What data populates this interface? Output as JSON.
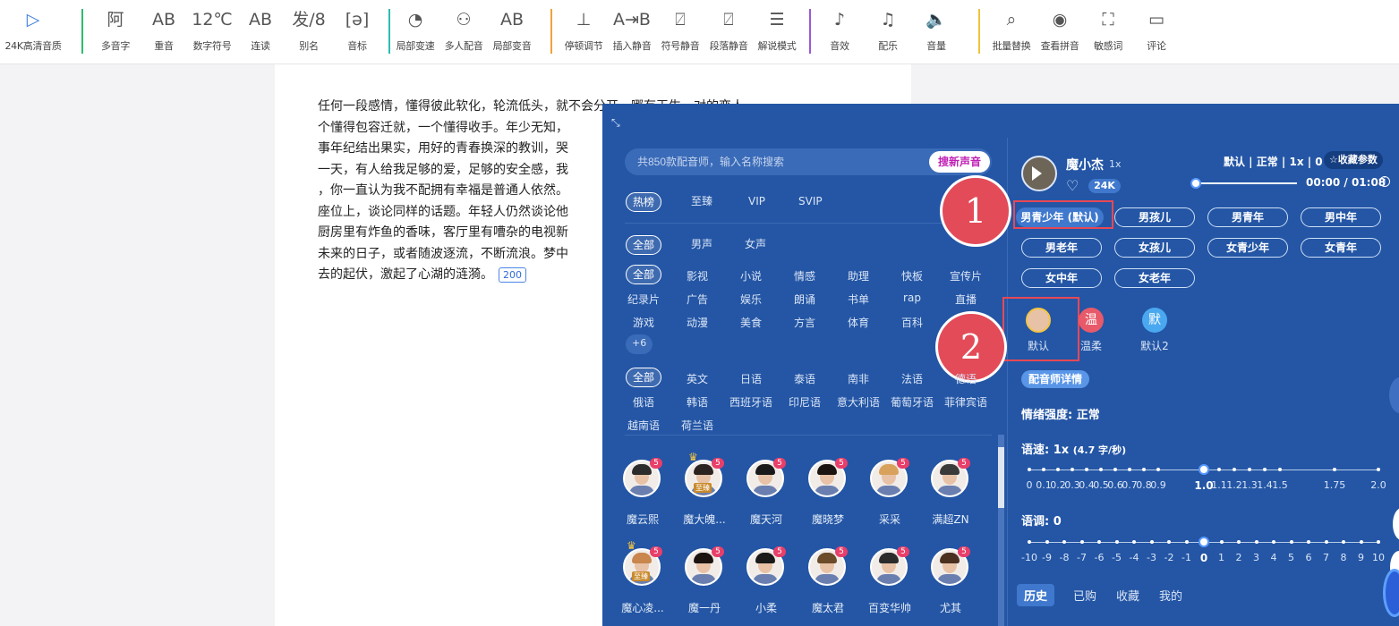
{
  "toolbar": {
    "items": [
      {
        "label": "24K高清音质",
        "icon": "play-circle-icon",
        "glyph": "▷"
      },
      {
        "label": "多音字",
        "icon": "polyphone-icon",
        "glyph": "阿"
      },
      {
        "label": "重音",
        "icon": "stress-icon",
        "glyph": "AB"
      },
      {
        "label": "数字符号",
        "icon": "number-symbol-icon",
        "glyph": "12℃"
      },
      {
        "label": "连读",
        "icon": "liaison-icon",
        "glyph": "AB"
      },
      {
        "label": "别名",
        "icon": "alias-icon",
        "glyph": "发/8"
      },
      {
        "label": "音标",
        "icon": "phonetic-icon",
        "glyph": "[ə]"
      },
      {
        "label": "局部变速",
        "icon": "speed-gauge-icon",
        "glyph": "◔"
      },
      {
        "label": "多人配音",
        "icon": "multi-person-icon",
        "glyph": "⚇"
      },
      {
        "label": "局部变音",
        "icon": "voice-change-icon",
        "glyph": "AB"
      },
      {
        "label": "停顿调节",
        "icon": "pause-adjust-icon",
        "glyph": "⊥"
      },
      {
        "label": "插入静音",
        "icon": "insert-silence-icon",
        "glyph": "A⇥B"
      },
      {
        "label": "符号静音",
        "icon": "symbol-silence-icon",
        "glyph": "⍁"
      },
      {
        "label": "段落静音",
        "icon": "paragraph-silence-icon",
        "glyph": "⍁"
      },
      {
        "label": "解说模式",
        "icon": "narration-mode-icon",
        "glyph": "☰"
      },
      {
        "label": "音效",
        "icon": "sound-effect-icon",
        "glyph": "♪"
      },
      {
        "label": "配乐",
        "icon": "music-icon",
        "glyph": "♫"
      },
      {
        "label": "音量",
        "icon": "volume-icon",
        "glyph": "🔈"
      },
      {
        "label": "批量替换",
        "icon": "search-icon",
        "glyph": "⌕"
      },
      {
        "label": "查看拼音",
        "icon": "eye-icon",
        "glyph": "◉"
      },
      {
        "label": "敏感词",
        "icon": "sensitive-word-icon",
        "glyph": "⛶"
      },
      {
        "label": "评论",
        "icon": "comment-icon",
        "glyph": "▭"
      }
    ]
  },
  "doc": {
    "lines": [
      "任何一段感情，懂得彼此软化，轮流低头，就不会分开，哪有天生一对的恋人",
      "个懂得包容迁就，一个懂得收手。年少无知，",
      "事年纪结出果实，用好的青春换深的教训，哭",
      "一天，有人给我足够的爱，足够的安全感，我",
      "，你一直认为我不配拥有幸福是普通人依然。",
      "座位上，谈论同样的话题。年轻人仍然谈论他",
      "厨房里有炸鱼的香味，客厅里有嘈杂的电视新",
      "未来的日子，或者随波逐流，不断流浪。梦中",
      "去的起伏，激起了心湖的涟漪。"
    ],
    "char_count": "200"
  },
  "panel": {
    "search_placeholder": "共850款配音师，输入名称搜索",
    "find_new": "搜新声音",
    "rank_tabs": [
      "热榜",
      "至臻",
      "VIP",
      "SVIP"
    ],
    "gender_tabs": [
      "全部",
      "男声",
      "女声"
    ],
    "categories": [
      "全部",
      "影视",
      "小说",
      "情感",
      "助理",
      "快板",
      "宣传片",
      "纪录片",
      "广告",
      "娱乐",
      "朗诵",
      "书单",
      "rap",
      "直播",
      "游戏",
      "动漫",
      "美食",
      "方言",
      "体育",
      "百科"
    ],
    "more": "+6",
    "languages": [
      "全部",
      "英文",
      "日语",
      "泰语",
      "南非",
      "法语",
      "德语",
      "俄语",
      "韩语",
      "西班牙语",
      "印尼语",
      "意大利语",
      "葡萄牙语",
      "菲律宾语",
      "越南语",
      "荷兰语"
    ],
    "voices": [
      {
        "name": "魔云熙",
        "badge": "5",
        "crown": ""
      },
      {
        "name": "魔大魄...",
        "badge": "5",
        "crown": "至臻"
      },
      {
        "name": "魔天河",
        "badge": "5",
        "crown": ""
      },
      {
        "name": "魔晓梦",
        "badge": "5",
        "crown": ""
      },
      {
        "name": "采采",
        "badge": "5",
        "crown": ""
      },
      {
        "name": "满超ZN",
        "badge": "5",
        "crown": ""
      },
      {
        "name": "魔心凌...",
        "badge": "5",
        "crown": "至臻"
      },
      {
        "name": "魔一丹",
        "badge": "5",
        "crown": ""
      },
      {
        "name": "小柔",
        "badge": "5",
        "crown": ""
      },
      {
        "name": "魔太君",
        "badge": "5",
        "crown": ""
      },
      {
        "name": "百变华帅",
        "badge": "5",
        "crown": ""
      },
      {
        "name": "尤其",
        "badge": "5",
        "crown": ""
      }
    ],
    "voice": {
      "name": "魔小杰",
      "speed": "1x",
      "quality": "24K",
      "params": "默认 | 正常 | 1x | 0",
      "fav_params": "☆收藏参数",
      "time_current": "00:00",
      "time_total": "/ 01:08",
      "progress": 0
    },
    "age_tags": [
      "男青少年 (默认)",
      "男孩儿",
      "男青年",
      "男中年",
      "男老年",
      "女孩儿",
      "女青少年",
      "女青年",
      "女中年",
      "女老年"
    ],
    "styles": [
      {
        "label": "默认",
        "glyph": ""
      },
      {
        "label": "温柔",
        "glyph": "温"
      },
      {
        "label": "默认2",
        "glyph": "默"
      }
    ],
    "voice_detail": "配音师详情",
    "emotion_label": "情绪强度:",
    "emotion_value": "正常",
    "speed_label": "语速:",
    "speed_value": "1x",
    "speed_sub": "(4.7 字/秒)",
    "speed_ticks": [
      "0",
      "0.1",
      "0.2",
      "0.3",
      "0.4",
      "0.5",
      "0.6",
      "0.7",
      "0.8",
      "0.9",
      "1.0",
      "1.1",
      "1.2",
      "1.3",
      "1.4",
      "1.5",
      "1.75",
      "2.0"
    ],
    "speed_selected": "1.0",
    "pitch_label": "语调:",
    "pitch_value": "0",
    "pitch_ticks": [
      "-10",
      "-9",
      "-8",
      "-7",
      "-6",
      "-5",
      "-4",
      "-3",
      "-2",
      "-1",
      "0",
      "1",
      "2",
      "3",
      "4",
      "5",
      "6",
      "7",
      "8",
      "9",
      "10"
    ],
    "pitch_selected": "0",
    "bottom_tabs": [
      "历史",
      "已购",
      "收藏",
      "我的"
    ],
    "annotations": [
      "1",
      "2"
    ]
  },
  "colors": {
    "panel": "#2456a5",
    "accent": "#3f78cc",
    "highlight": "#e84855",
    "find_new_text": "#c01fb6"
  }
}
